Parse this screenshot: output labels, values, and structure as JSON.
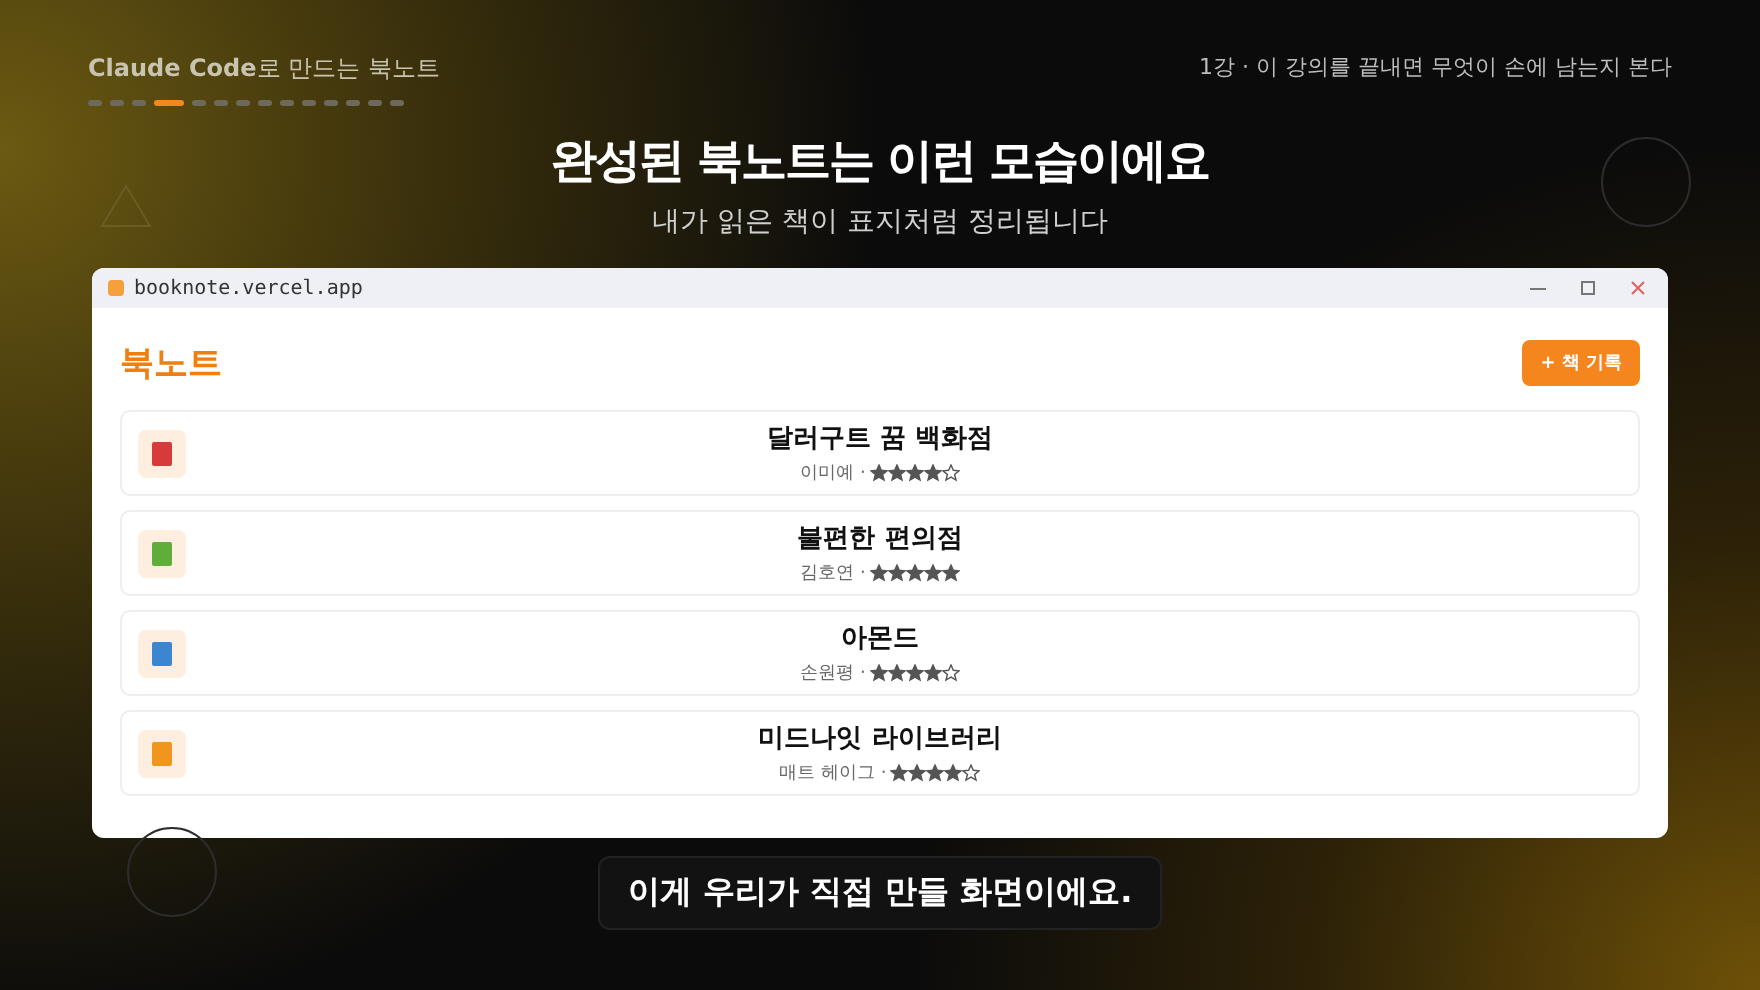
{
  "top_bar": {
    "course_title": "**Claude Code**로 만드는 북노트",
    "lesson": "1강 · 이 강의를 끝내면 무엇이 손에 남는지 본다"
  },
  "progress_steps": [
    {
      "selected": false
    },
    {
      "selected": false
    },
    {
      "selected": false
    },
    {
      "selected": true
    },
    {
      "selected": false
    },
    {
      "selected": false
    },
    {
      "selected": false
    },
    {
      "selected": false
    },
    {
      "selected": false
    },
    {
      "selected": false
    },
    {
      "selected": false
    },
    {
      "selected": false
    },
    {
      "selected": false
    },
    {
      "selected": false
    }
  ],
  "headline": "완성된 북노트는 이런 모습이에요",
  "subtitle": "내가 읽은 책이 표지처럼 정리됩니다",
  "window": {
    "url": "booknote.vercel.app",
    "app_title": "북노트",
    "add_button": "+ 책 기록",
    "books": [
      {
        "title": "달러구트 꿈 백화점",
        "author": "이미예 ·",
        "stars": 4,
        "color": "#d63a3a"
      },
      {
        "title": "불편한 편의점",
        "author": "김호연 ·",
        "stars": 5,
        "color": "#5fae3a"
      },
      {
        "title": "아몬드",
        "author": "손원평 ·",
        "stars": 4,
        "color": "#3a86d0"
      },
      {
        "title": "미드나잇 라이브러리",
        "author": "매트 헤이그 ·",
        "stars": 4,
        "color": "#f0961e"
      }
    ]
  },
  "caption": "이게 우리가 직접 만들 화면이에요."
}
